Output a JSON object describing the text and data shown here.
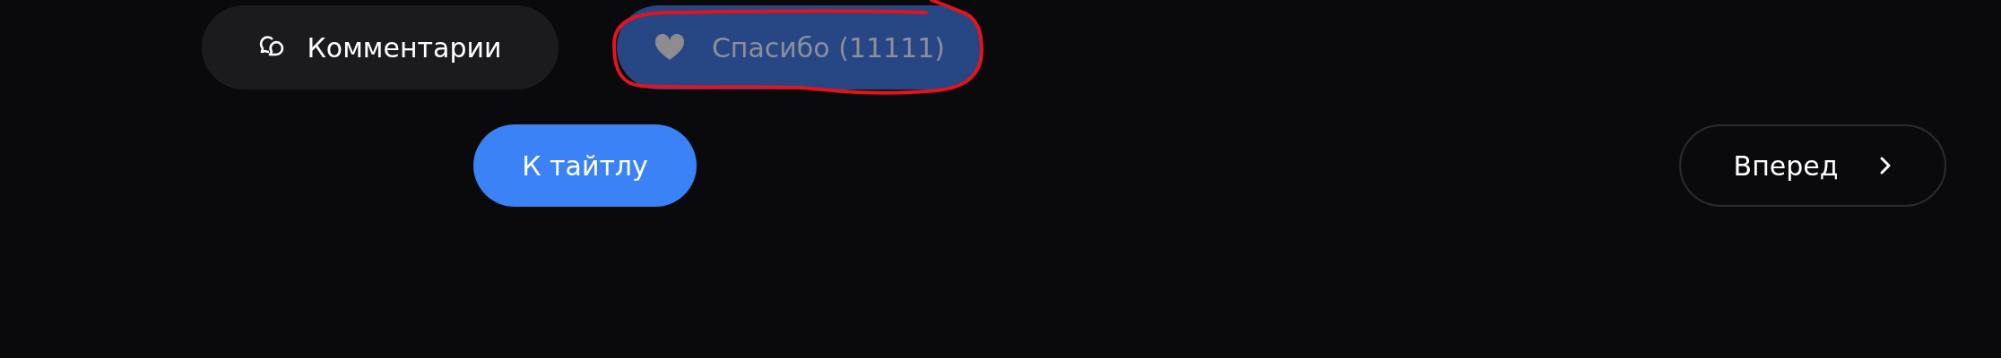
{
  "actions": [
    {
      "kind": "comments",
      "label": "Комментарии"
    },
    {
      "kind": "thanks",
      "label": "Спасибо (11111)",
      "disabled": true,
      "highlighted": true
    }
  ],
  "navigation": [
    {
      "kind": "primary",
      "label": "К тайтлу"
    },
    {
      "kind": "next",
      "label": "Вперед"
    }
  ]
}
